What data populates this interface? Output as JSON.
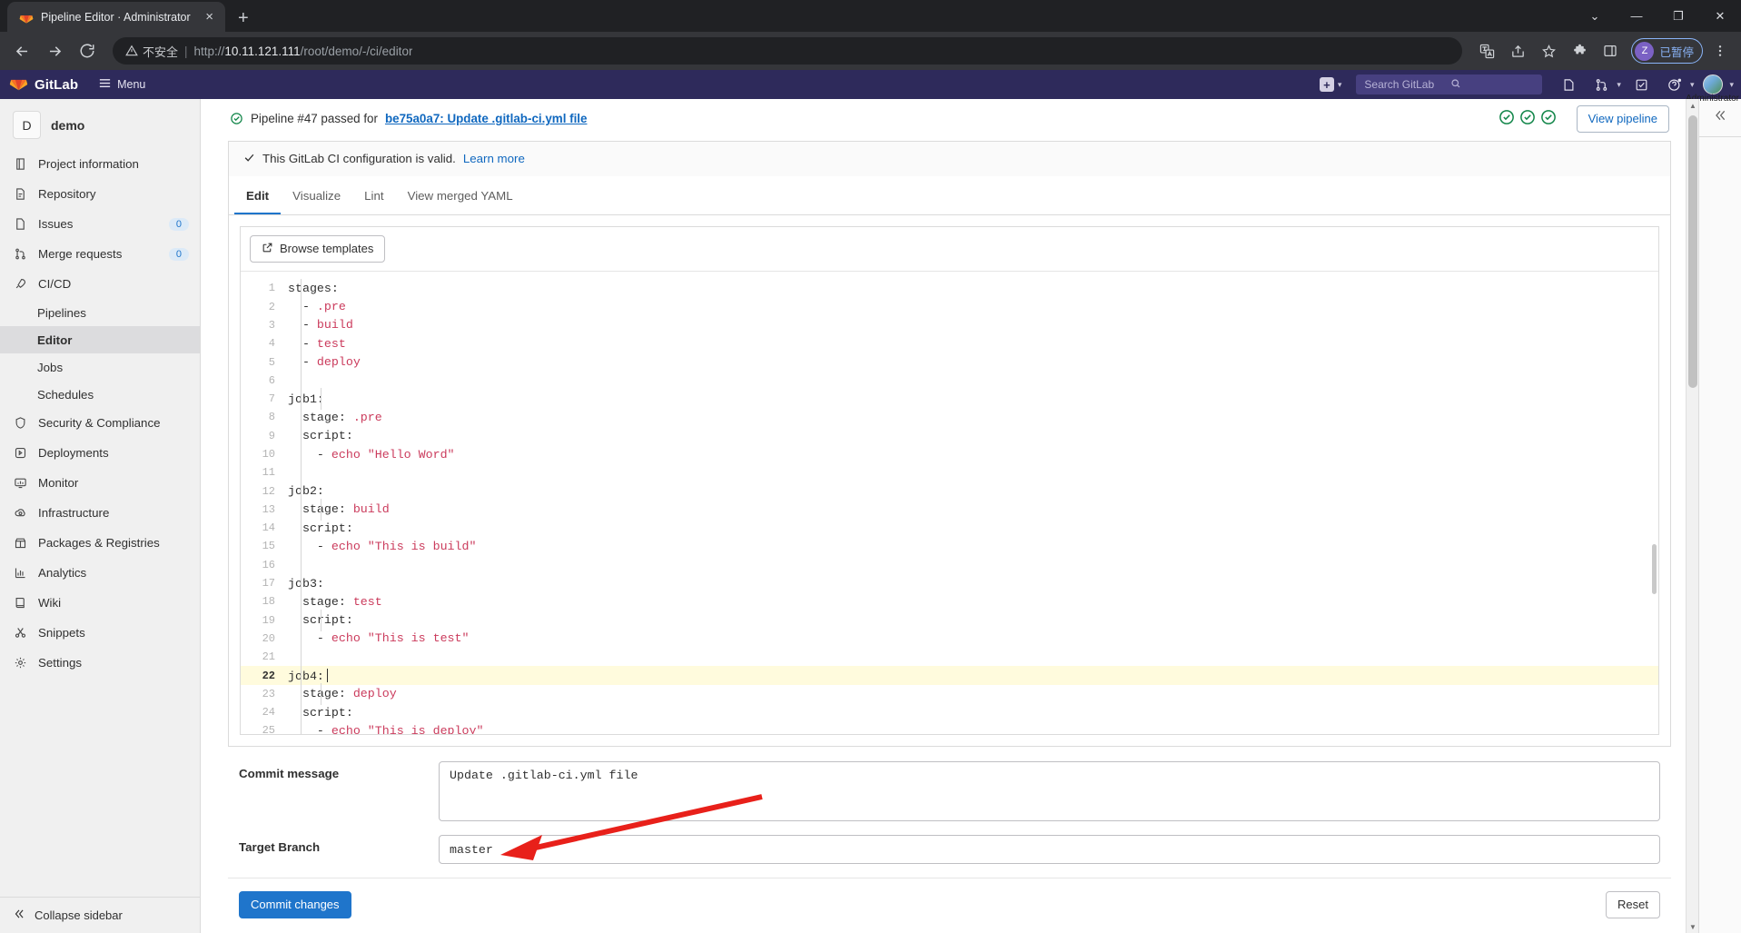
{
  "browser": {
    "tab": {
      "title": "Pipeline Editor · Administrator",
      "favicon": "gitlab-favicon",
      "close": "×"
    },
    "newtab_label": "+",
    "window_controls": {
      "minimize": "—",
      "maximize": "❐",
      "close": "✕",
      "more": "⌄"
    },
    "address": {
      "security_label": "不安全",
      "separator": "|",
      "scheme": "http://",
      "host": "10.11.121.111",
      "path": "/root/demo/-/ci/editor",
      "full_url": "http://10.11.121.111/root/demo/-/ci/editor"
    },
    "toolbar_icons": [
      "translate-icon",
      "share-icon",
      "bookmark-star-icon",
      "extensions-puzzle-icon",
      "side-panel-icon",
      "browser-menu-icon"
    ],
    "profile": {
      "initial": "Z",
      "status_label": "已暂停"
    }
  },
  "gitlab_header": {
    "brand": "GitLab",
    "menu_label": "Menu",
    "plus_label": "+",
    "search_placeholder": "Search GitLab",
    "icons": [
      "issues-icon",
      "merge-requests-icon",
      "todos-icon",
      "help-icon"
    ],
    "user_name": "Administrator"
  },
  "sidebar": {
    "project": {
      "avatar_letter": "D",
      "name": "demo"
    },
    "items": [
      {
        "label": "Project information",
        "icon": "doc-chart-icon"
      },
      {
        "label": "Repository",
        "icon": "file-icon"
      },
      {
        "label": "Issues",
        "icon": "issues-icon",
        "badge": "0"
      },
      {
        "label": "Merge requests",
        "icon": "merge-requests-icon",
        "badge": "0"
      },
      {
        "label": "CI/CD",
        "icon": "rocket-icon"
      }
    ],
    "cicd_children": [
      {
        "label": "Pipelines",
        "active": false
      },
      {
        "label": "Editor",
        "active": true
      },
      {
        "label": "Jobs",
        "active": false
      },
      {
        "label": "Schedules",
        "active": false
      }
    ],
    "items_after": [
      {
        "label": "Security & Compliance",
        "icon": "shield-icon"
      },
      {
        "label": "Deployments",
        "icon": "deployments-icon"
      },
      {
        "label": "Monitor",
        "icon": "monitor-icon"
      },
      {
        "label": "Infrastructure",
        "icon": "infrastructure-icon"
      },
      {
        "label": "Packages & Registries",
        "icon": "package-icon"
      },
      {
        "label": "Analytics",
        "icon": "analytics-icon"
      },
      {
        "label": "Wiki",
        "icon": "wiki-icon"
      },
      {
        "label": "Snippets",
        "icon": "snippets-icon"
      },
      {
        "label": "Settings",
        "icon": "gear-icon"
      }
    ],
    "collapse_label": "Collapse sidebar",
    "collapse_icon": "chevron-double-left-icon"
  },
  "pipeline_status": {
    "status_icon": "status-success-icon",
    "text_prefix": "Pipeline #47 passed for",
    "commit_link": "be75a0a7: Update .gitlab-ci.yml file",
    "stage_icons": [
      "stage-success-icon",
      "stage-success-icon",
      "stage-success-icon"
    ],
    "view_pipeline_label": "View pipeline"
  },
  "validation": {
    "check_icon": "check-icon",
    "message": "This GitLab CI configuration is valid.",
    "learn_more": "Learn more"
  },
  "tabs": [
    {
      "label": "Edit",
      "active": true
    },
    {
      "label": "Visualize",
      "active": false
    },
    {
      "label": "Lint",
      "active": false
    },
    {
      "label": "View merged YAML",
      "active": false
    }
  ],
  "editor": {
    "browse_templates_label": "Browse templates",
    "browse_templates_icon": "external-link-icon",
    "active_line": 22,
    "lines": [
      {
        "n": 1,
        "indent": 0,
        "key": "stages:",
        "value": ""
      },
      {
        "n": 2,
        "indent": 1,
        "key": "- ",
        "value": ".pre"
      },
      {
        "n": 3,
        "indent": 1,
        "key": "- ",
        "value": "build"
      },
      {
        "n": 4,
        "indent": 1,
        "key": "- ",
        "value": "test"
      },
      {
        "n": 5,
        "indent": 1,
        "key": "- ",
        "value": "deploy"
      },
      {
        "n": 6,
        "indent": 0,
        "key": "",
        "value": ""
      },
      {
        "n": 7,
        "indent": 0,
        "key": "job1:",
        "value": ""
      },
      {
        "n": 8,
        "indent": 1,
        "key": "stage: ",
        "value": ".pre"
      },
      {
        "n": 9,
        "indent": 1,
        "key": "script:",
        "value": ""
      },
      {
        "n": 10,
        "indent": 2,
        "key": "- ",
        "value": "echo \"Hello Word\""
      },
      {
        "n": 11,
        "indent": 0,
        "key": "",
        "value": ""
      },
      {
        "n": 12,
        "indent": 0,
        "key": "job2:",
        "value": ""
      },
      {
        "n": 13,
        "indent": 1,
        "key": "stage: ",
        "value": "build"
      },
      {
        "n": 14,
        "indent": 1,
        "key": "script:",
        "value": ""
      },
      {
        "n": 15,
        "indent": 2,
        "key": "- ",
        "value": "echo \"This is build\""
      },
      {
        "n": 16,
        "indent": 0,
        "key": "",
        "value": ""
      },
      {
        "n": 17,
        "indent": 0,
        "key": "job3:",
        "value": ""
      },
      {
        "n": 18,
        "indent": 1,
        "key": "stage: ",
        "value": "test"
      },
      {
        "n": 19,
        "indent": 1,
        "key": "script:",
        "value": ""
      },
      {
        "n": 20,
        "indent": 2,
        "key": "- ",
        "value": "echo \"This is test\""
      },
      {
        "n": 21,
        "indent": 0,
        "key": "",
        "value": ""
      },
      {
        "n": 22,
        "indent": 0,
        "key": "job4:",
        "value": ""
      },
      {
        "n": 23,
        "indent": 1,
        "key": "stage: ",
        "value": "deploy"
      },
      {
        "n": 24,
        "indent": 1,
        "key": "script:",
        "value": ""
      },
      {
        "n": 25,
        "indent": 2,
        "key": "- ",
        "value": "echo \"This is deploy\""
      }
    ]
  },
  "commit_form": {
    "commit_message_label": "Commit message",
    "commit_message_value": "Update .gitlab-ci.yml file",
    "target_branch_label": "Target Branch",
    "target_branch_value": "master",
    "commit_button_label": "Commit changes",
    "reset_button_label": "Reset"
  },
  "right_rail": {
    "collapse_icon": "chevron-double-left-icon"
  },
  "colors": {
    "gitlab_purple": "#2e2a5b",
    "primary_blue": "#1f75cb",
    "link_blue": "#1068bf",
    "success_green": "#108548",
    "yaml_value_red": "#cb3b5c",
    "annotation_red": "#e8201a",
    "active_line": "#fffbdd"
  }
}
